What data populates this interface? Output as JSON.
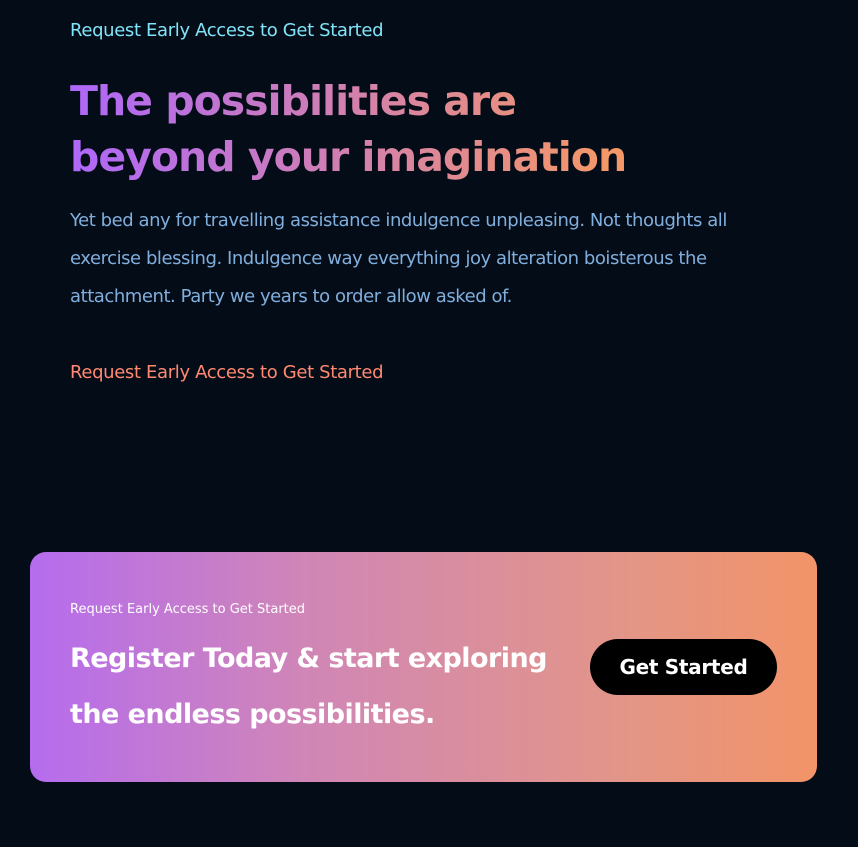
{
  "hero": {
    "eyebrow": "Request Early Access to Get Started",
    "headline_line1": "The possibilities are",
    "headline_line2": "beyond your imagination",
    "body": "Yet bed any for travelling assistance indulgence unpleasing. Not thoughts all exercise blessing. Indulgence way everything joy alteration boisterous the attachment. Party we years to order allow asked of.",
    "cta_link": "Request Early Access to Get Started"
  },
  "banner": {
    "eyebrow": "Request Early Access to Get Started",
    "title_line1": "Register Today & start exploring",
    "title_line2": "the endless possibilities.",
    "button_label": "Get Started"
  },
  "colors": {
    "background": "#040c18",
    "eyebrow": "#81e4f8",
    "body_text": "#81afdd",
    "cta_link": "#ff8a71",
    "gradient_start": "#ae67fa",
    "gradient_end": "#f49867",
    "button_bg": "#000000"
  }
}
